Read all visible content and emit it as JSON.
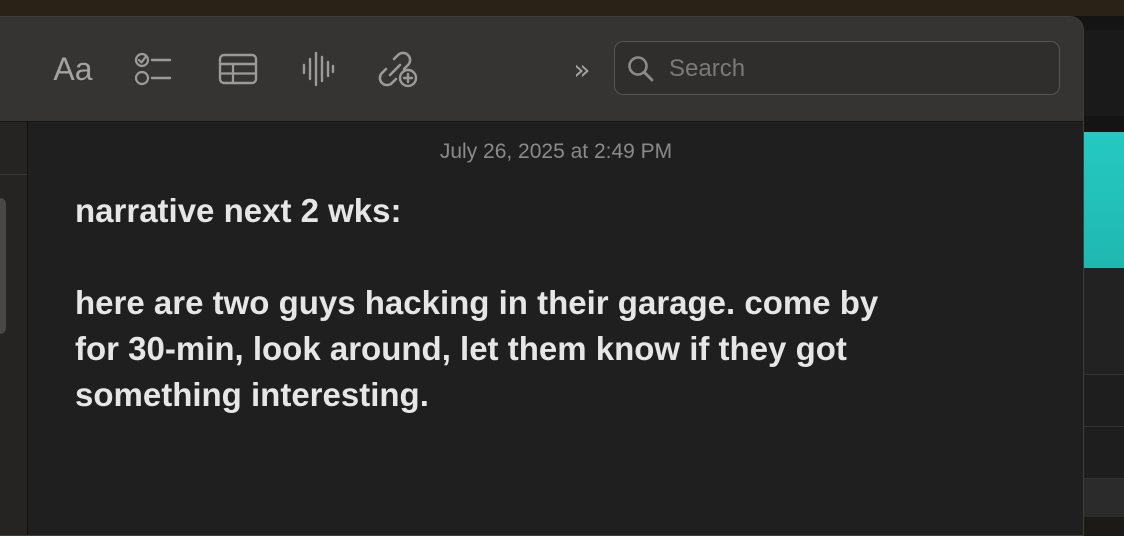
{
  "toolbar": {
    "format_label": "Aa",
    "format_icon": "text-format-icon",
    "checklist_icon": "checklist-icon",
    "table_icon": "table-icon",
    "audio_icon": "waveform-icon",
    "collaborate_icon": "collaborate-link-add-icon",
    "more_label": "»",
    "more_icon": "chevron-double-right-icon"
  },
  "search": {
    "placeholder": "Search",
    "value": "",
    "icon": "search-icon"
  },
  "note": {
    "timestamp": "July 26, 2025 at 2:49 PM",
    "lines": [
      "narrative next 2 wks:",
      "",
      "here are two guys hacking in their garage. come by",
      "for 30-min, look around, let them know if they got",
      "something interesting."
    ]
  },
  "colors": {
    "window_bg": "#1f1f1f",
    "toolbar_bg": "#353433",
    "text_primary": "#e6e6e6",
    "text_secondary": "#8a8a8a",
    "accent_teal": "#25c9c2"
  }
}
